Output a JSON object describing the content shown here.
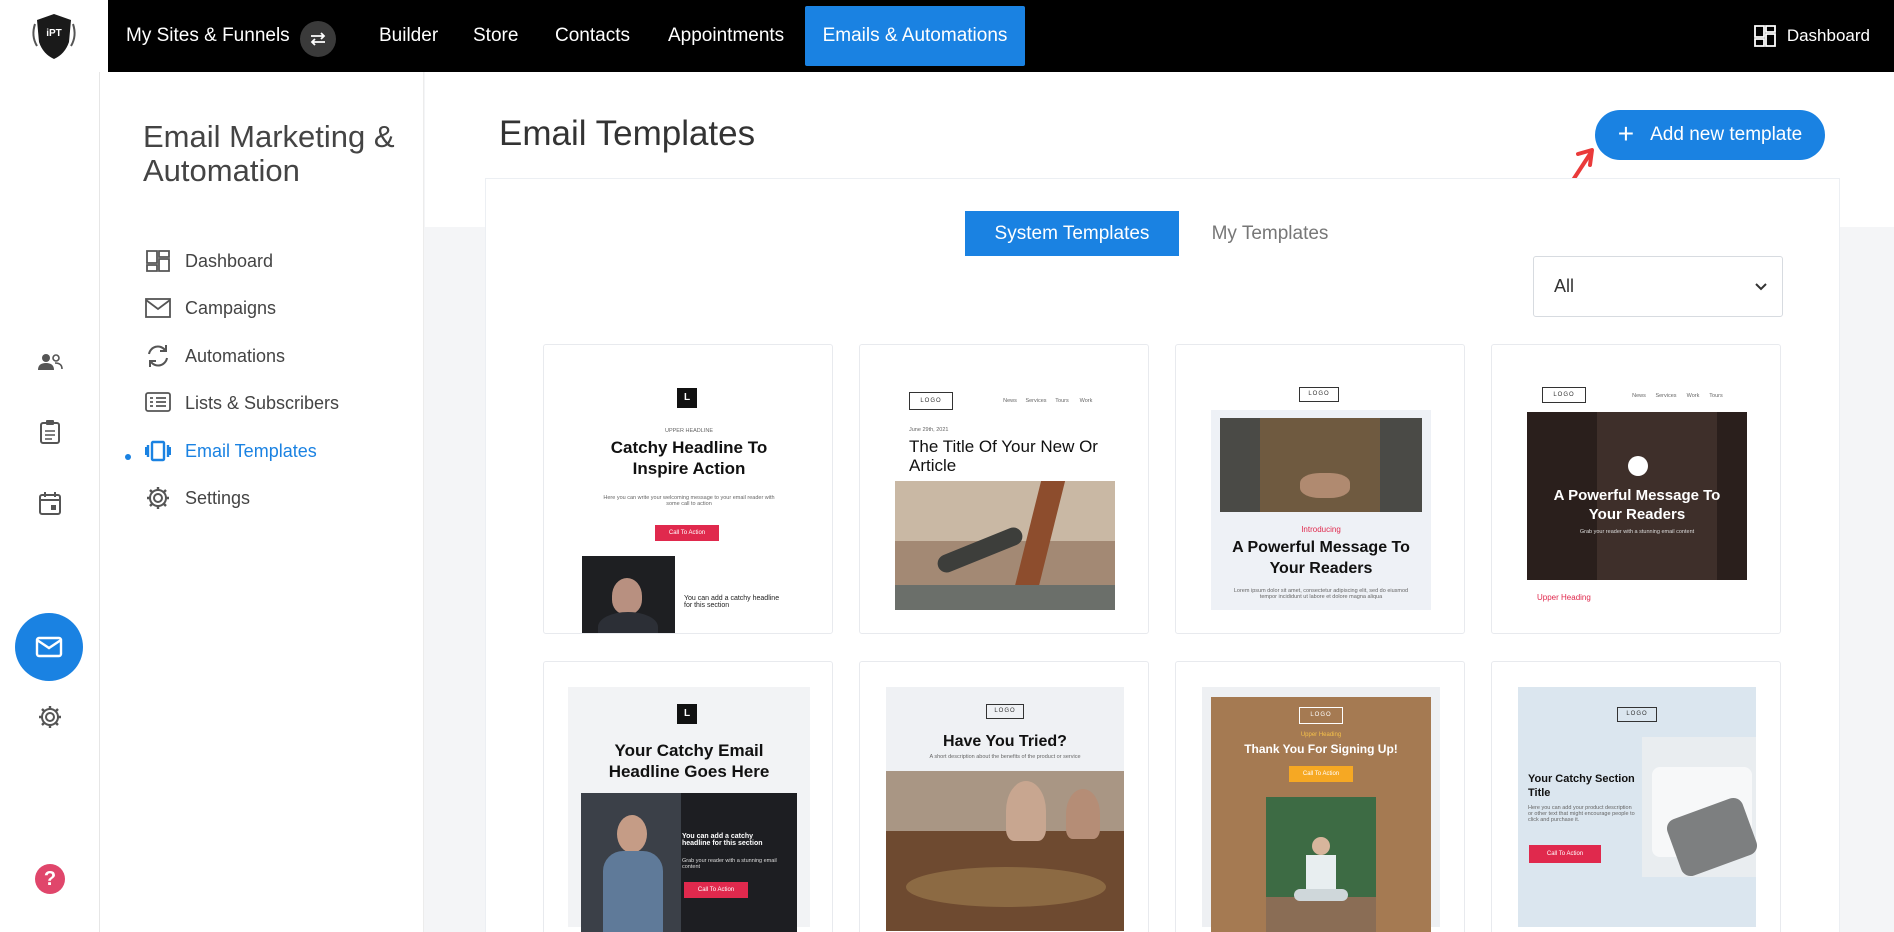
{
  "topbar": {
    "brand": "iPT",
    "nav": [
      "My Sites & Funnels",
      "Builder",
      "Store",
      "Contacts",
      "Appointments"
    ],
    "active": "Emails & Automations",
    "dashboard": "Dashboard"
  },
  "sidebar": {
    "title": "Email Marketing & Automation",
    "items": [
      {
        "label": "Dashboard",
        "icon": "dashboard-icon"
      },
      {
        "label": "Campaigns",
        "icon": "envelope-icon"
      },
      {
        "label": "Automations",
        "icon": "refresh-icon"
      },
      {
        "label": "Lists & Subscribers",
        "icon": "list-icon"
      },
      {
        "label": "Email Templates",
        "icon": "templates-icon"
      },
      {
        "label": "Settings",
        "icon": "gear-icon"
      }
    ],
    "active_index": 4
  },
  "main": {
    "title": "Email Templates",
    "add_button": "Add new template",
    "tabs": [
      "System Templates",
      "My Templates"
    ],
    "filter_value": "All",
    "accent": "#1a82e2"
  },
  "templates": [
    {
      "logo": "L",
      "upper": "UPPER HEADLINE",
      "headline": "Catchy Headline To Inspire Action",
      "body": "Here you can write your welcoming message to your email reader with some call to action",
      "cta": "Call To Action",
      "caption": "You can add a catchy headline for this section"
    },
    {
      "logo": "LOGO",
      "nav": [
        "News",
        "Services",
        "Tours",
        "Work"
      ],
      "date": "June 29th, 2021",
      "headline": "The Title Of Your New Or Article"
    },
    {
      "logo": "LOGO",
      "upper": "Introducing",
      "headline": "A Powerful Message To Your Readers",
      "body": "Lorem ipsum dolor sit amet, consectetur adipiscing elit, sed do eiusmod tempor incididunt ut labore et dolore magna aliqua"
    },
    {
      "logo": "LOGO",
      "nav": [
        "News",
        "Services",
        "Work",
        "Tours"
      ],
      "headline": "A Powerful Message To Your Readers",
      "sub": "Grab your reader with a stunning email content",
      "upper": "Upper Heading"
    },
    {
      "logo": "L",
      "headline": "Your Catchy Email Headline Goes Here",
      "overlay": "You can add a catchy headline for this section",
      "sub": "Grab your reader with a stunning email content",
      "cta": "Call To Action"
    },
    {
      "logo": "LOGO",
      "headline": "Have You Tried?",
      "sub": "A short description about the benefits of the product or service"
    },
    {
      "logo": "LOGO",
      "upper": "Upper Heading",
      "headline": "Thank You For Signing Up!",
      "cta": "Call To Action"
    },
    {
      "logo": "LOGO",
      "headline": "Your Catchy Section Title",
      "body": "Here you can add your product description or other text that might encourage people to click and purchase it.",
      "cta": "Call To Action"
    }
  ]
}
